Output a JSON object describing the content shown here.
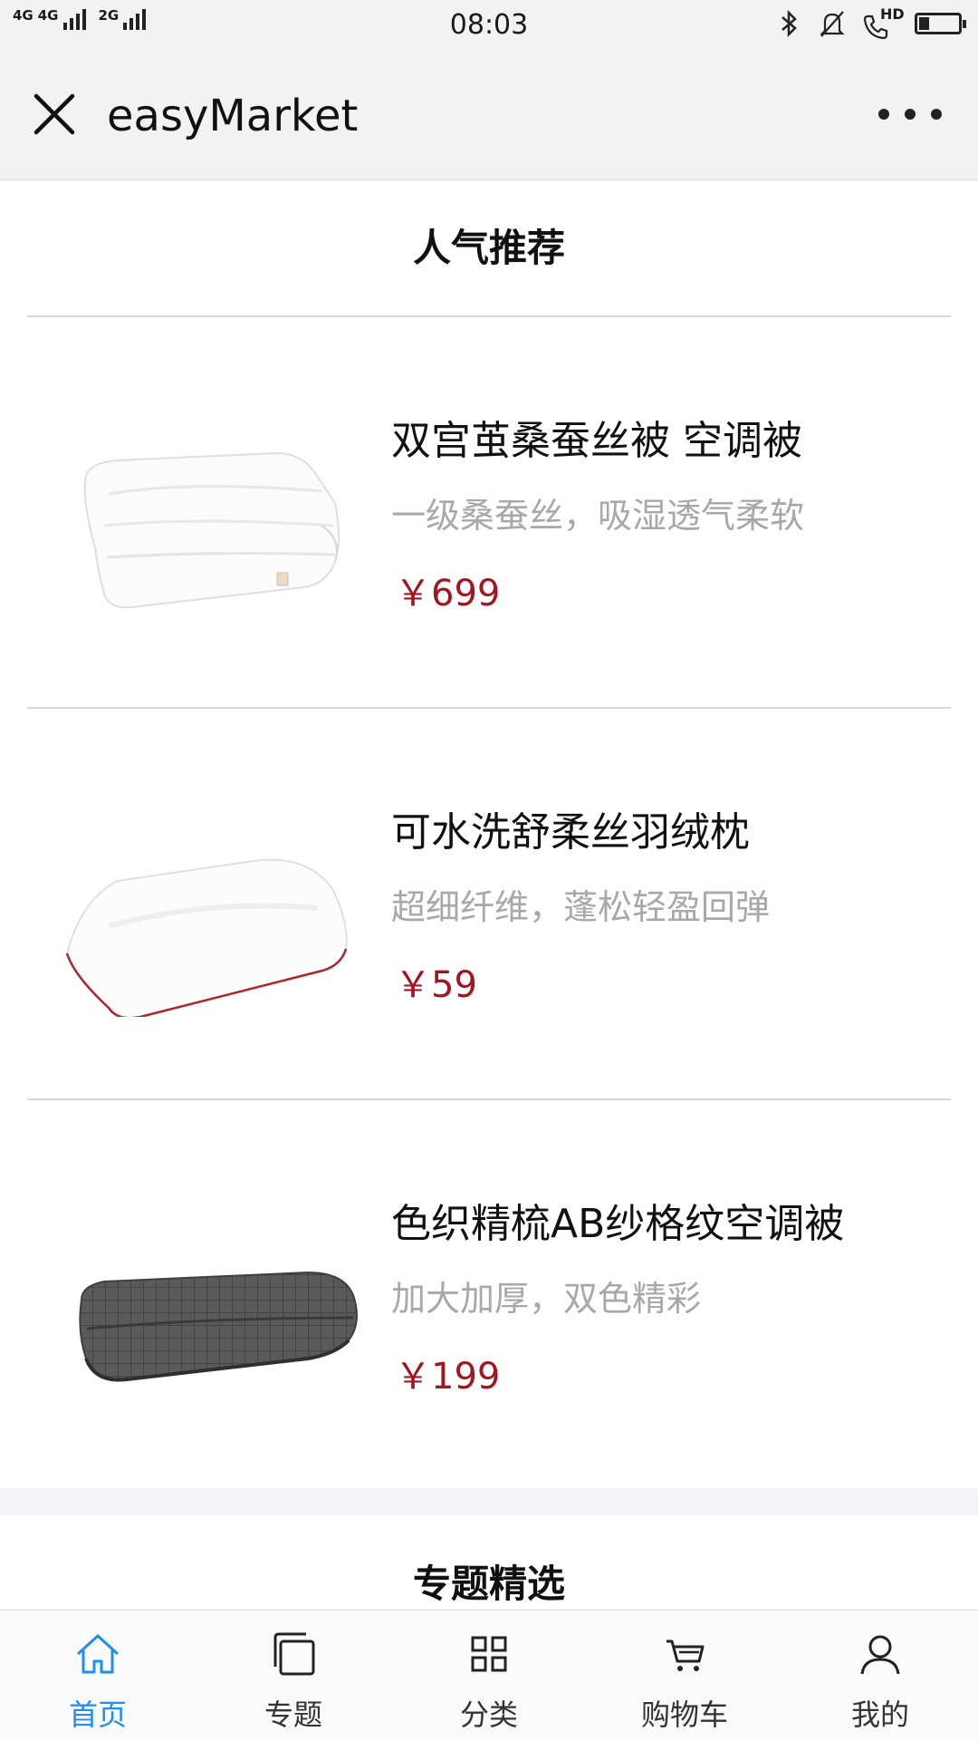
{
  "status_bar": {
    "time": "08:03",
    "signal_1_label": "4G",
    "signal_1b_label": "4G",
    "signal_2_label": "2G",
    "hd_label": "HD",
    "battery_level": 0.25
  },
  "nav": {
    "title": "easyMarket"
  },
  "hot_section": {
    "title": "人气推荐",
    "products": [
      {
        "name": "双宫茧桑蚕丝被 空调被",
        "brief": "一级桑蚕丝，吸湿透气柔软",
        "price": "￥699",
        "image": "white-quilt"
      },
      {
        "name": "可水洗舒柔丝羽绒枕",
        "brief": "超细纤维，蓬松轻盈回弹",
        "price": "￥59",
        "image": "white-pillow"
      },
      {
        "name": "色织精梳AB纱格纹空调被",
        "brief": "加大加厚，双色精彩",
        "price": "￥199",
        "image": "gray-blanket"
      }
    ]
  },
  "topic_section": {
    "title": "专题精选"
  },
  "tabs": [
    {
      "label": "首页",
      "icon": "home-icon",
      "active": true
    },
    {
      "label": "专题",
      "icon": "topic-icon",
      "active": false
    },
    {
      "label": "分类",
      "icon": "category-icon",
      "active": false
    },
    {
      "label": "购物车",
      "icon": "cart-icon",
      "active": false
    },
    {
      "label": "我的",
      "icon": "user-icon",
      "active": false
    }
  ],
  "colors": {
    "accent": "#1f8ef1",
    "price": "#a31621",
    "brief": "#a8a8a8"
  }
}
